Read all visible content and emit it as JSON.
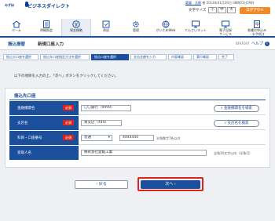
{
  "header": {
    "logo_mark": "みずほ",
    "logo_text": "ビジネスダイレクト",
    "user": "愛媛　太郎",
    "user_suffix": "様",
    "last_login": "2014年01月30日 08時01分59秒",
    "font_size_label": "文字サイズ",
    "font_small": "小",
    "font_medium": "中",
    "font_large": "大",
    "logout_label": "ログアウト"
  },
  "nav": [
    {
      "label": "ホーム",
      "icon": "house-icon"
    },
    {
      "label": "明細照会",
      "icon": "document-icon"
    },
    {
      "label": "資金移動",
      "icon": "yen-transfer-icon"
    },
    {
      "label": "承認",
      "icon": "approval-icon"
    },
    {
      "label": "管理",
      "icon": "gear-icon"
    },
    {
      "label": "がいためWeb",
      "icon": "globe-icon"
    },
    {
      "label": "でんさいネット",
      "icon": "monitor-icon"
    },
    {
      "label": "電子記録\nサービス",
      "icon": "monitor-icon"
    },
    {
      "label": "各種お申込み\n・お手続き",
      "icon": "form-icon"
    }
  ],
  "page": {
    "title_main": "振込振替",
    "title_sub": "新規口座入力",
    "code": "BFKF007",
    "help_label": "ヘルプ"
  },
  "steps": [
    "振込元口座を選択",
    "振込先口座指定方法を選択",
    "振込口座を選択",
    "支払金額を入力",
    "内容確認",
    "実行確認",
    "完了"
  ],
  "guide": "以下の項目を入力の上、「次へ」ボタンをクリックしてください。",
  "section_title": "振込先口座",
  "required_label": "必須",
  "form": {
    "bank": {
      "label": "金融機関名",
      "value": "〇〇銀行（9999）",
      "button": "金融機関名を検索"
    },
    "branch": {
      "label": "支店名",
      "value": "東支店（444）",
      "button": "支店名を検索"
    },
    "account": {
      "label": "科目・口座番号",
      "type": "普通",
      "number": "4444444",
      "note": "半角数字7桁以内"
    },
    "payee": {
      "label": "受取人名",
      "value": "株式会社愛媛工業",
      "note": "全角30文字以内（半角可）"
    }
  },
  "buttons": {
    "back": "戻る",
    "next": "次へ"
  },
  "colors": {
    "primary": "#1b4f9c",
    "required": "#d9241b",
    "logout": "#f08a24"
  }
}
